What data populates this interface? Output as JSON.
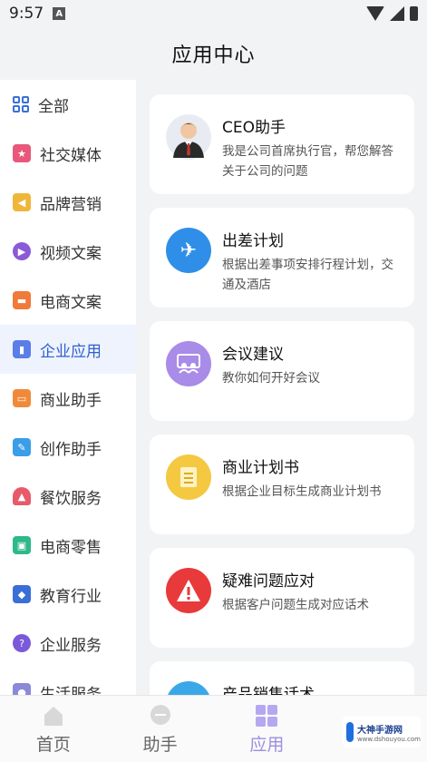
{
  "status_bar": {
    "time": "9:57",
    "notif_icon": "A"
  },
  "header": {
    "title": "应用中心"
  },
  "sidebar": {
    "items": [
      {
        "label": "全部",
        "icon": "grid-icon",
        "color": "#3a6fd8"
      },
      {
        "label": "社交媒体",
        "icon": "star-icon",
        "color": "#e8587a"
      },
      {
        "label": "品牌营销",
        "icon": "megaphone-icon",
        "color": "#f0b63a"
      },
      {
        "label": "视频文案",
        "icon": "play-icon",
        "color": "#8a5ad8"
      },
      {
        "label": "电商文案",
        "icon": "cart-icon",
        "color": "#f07a3a"
      },
      {
        "label": "企业应用",
        "icon": "chart-icon",
        "color": "#5a7de8",
        "active": true
      },
      {
        "label": "商业助手",
        "icon": "briefcase-icon",
        "color": "#f08a3a"
      },
      {
        "label": "创作助手",
        "icon": "edit-icon",
        "color": "#3a9ee8"
      },
      {
        "label": "餐饮服务",
        "icon": "dish-icon",
        "color": "#e85a6a"
      },
      {
        "label": "电商零售",
        "icon": "shop-icon",
        "color": "#2fb88a"
      },
      {
        "label": "教育行业",
        "icon": "graduation-icon",
        "color": "#3a6fd8"
      },
      {
        "label": "企业服务",
        "icon": "help-icon",
        "color": "#7a5ad8"
      },
      {
        "label": "生活服务",
        "icon": "life-icon",
        "color": "#8a8ad8"
      }
    ]
  },
  "cards": [
    {
      "title": "CEO助手",
      "desc": "我是公司首席执行官，帮您解答关于公司的问题",
      "icon": "ceo-avatar-icon",
      "color": "#e8ecf2"
    },
    {
      "title": "出差计划",
      "desc": "根据出差事项安排行程计划，交通及酒店",
      "icon": "airplane-icon",
      "color": "#2f8fe8"
    },
    {
      "title": "会议建议",
      "desc": "教你如何开好会议",
      "icon": "meeting-icon",
      "color": "#a98be8"
    },
    {
      "title": "商业计划书",
      "desc": "根据企业目标生成商业计划书",
      "icon": "document-icon",
      "color": "#f5c842"
    },
    {
      "title": "疑难问题应对",
      "desc": "根据客户问题生成对应话术",
      "icon": "warning-icon",
      "color": "#e83a3a"
    },
    {
      "title": "产品销售话术",
      "desc": "",
      "icon": "sales-icon",
      "color": "#3aa8e8"
    }
  ],
  "bottom_nav": {
    "items": [
      {
        "label": "首页",
        "icon": "home-icon"
      },
      {
        "label": "助手",
        "icon": "chat-icon"
      },
      {
        "label": "应用",
        "icon": "apps-icon",
        "active": true
      },
      {
        "label": "",
        "icon": ""
      }
    ]
  },
  "watermark": {
    "name": "大神手游网",
    "url": "www.dshouyou.com"
  }
}
